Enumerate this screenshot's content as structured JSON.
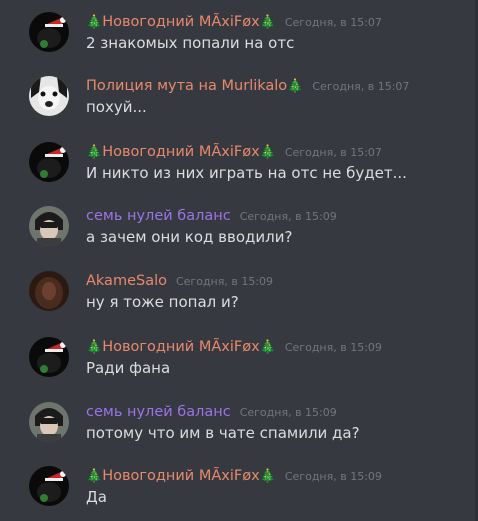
{
  "colors": {
    "background": "#36393f",
    "timestamp": "#72767d",
    "message_text": "#dcddde",
    "tree_emoji": "#3ba55d"
  },
  "messages": [
    {
      "avatar": "santa-hat-black-avatar",
      "username_prefix": "🎄",
      "username": "Новогодний MÃxiFøx",
      "username_suffix": "🎄",
      "username_color": "#e8896c",
      "timestamp": "Сегодня, в 15:07",
      "text": "2 знакомых попали на отс"
    },
    {
      "avatar": "dog-face-avatar",
      "username_prefix": "",
      "username": "Полиция мута на Murlikalo",
      "username_suffix": "🎄",
      "username_color": "#e8896c",
      "timestamp": "Сегодня, в 15:07",
      "text": "похуй..."
    },
    {
      "avatar": "santa-hat-black-avatar",
      "username_prefix": "🎄",
      "username": "Новогодний MÃxiFøx",
      "username_suffix": "🎄",
      "username_color": "#e8896c",
      "timestamp": "Сегодня, в 15:07",
      "text": "И никто из них играть на отс не будет..."
    },
    {
      "avatar": "anime-character-avatar",
      "username_prefix": "",
      "username": "семь нулей баланс",
      "username_suffix": "",
      "username_color": "#9b74e6",
      "timestamp": "Сегодня, в 15:09",
      "text": "а зачем они код вводили?"
    },
    {
      "avatar": "dark-brown-avatar",
      "username_prefix": "",
      "username": "AkameSalo",
      "username_suffix": "",
      "username_color": "#e8896c",
      "timestamp": "Сегодня, в 15:09",
      "text": "ну я тоже попал и?"
    },
    {
      "avatar": "santa-hat-black-avatar",
      "username_prefix": "🎄",
      "username": "Новогодний MÃxiFøx",
      "username_suffix": "🎄",
      "username_color": "#e8896c",
      "timestamp": "Сегодня, в 15:09",
      "text": "Ради фана"
    },
    {
      "avatar": "anime-character-avatar",
      "username_prefix": "",
      "username": "семь нулей баланс",
      "username_suffix": "",
      "username_color": "#9b74e6",
      "timestamp": "Сегодня, в 15:09",
      "text": "потому что им в чате спамили да?"
    },
    {
      "avatar": "santa-hat-black-avatar",
      "username_prefix": "🎄",
      "username": "Новогодний MÃxiFøx",
      "username_suffix": "🎄",
      "username_color": "#e8896c",
      "timestamp": "Сегодня, в 15:09",
      "text": "Да"
    }
  ]
}
